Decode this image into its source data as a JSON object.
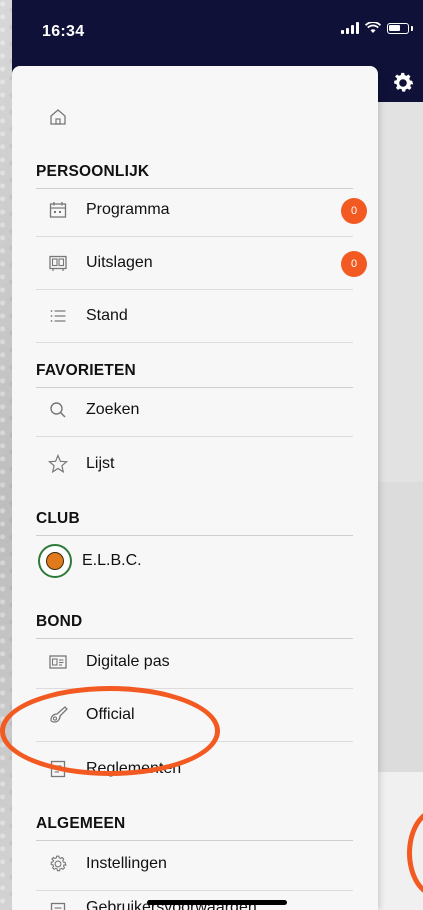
{
  "status": {
    "time": "16:34"
  },
  "menu": {
    "home": "Home",
    "sections": {
      "persoonlijk": "PERSOONLIJK",
      "favorieten": "FAVORIETEN",
      "club": "CLUB",
      "bond": "BOND",
      "algemeen": "ALGEMEEN"
    },
    "items": {
      "programma": "Programma",
      "programma_badge": "0",
      "uitslagen": "Uitslagen",
      "uitslagen_badge": "0",
      "stand": "Stand",
      "zoeken": "Zoeken",
      "lijst": "Lijst",
      "club_name": "E.L.B.C.",
      "digitale_pas": "Digitale pas",
      "official": "Official",
      "reglementen": "Reglementen",
      "instellingen": "Instellingen",
      "gebruikersvoorwaarden": "Gebruikersvoorwaarden"
    }
  },
  "colors": {
    "status_bar": "#0f1138",
    "badge": "#f25a22",
    "annotation": "#f25a22"
  },
  "icons": [
    "home-icon",
    "calendar-icon",
    "scoreboard-icon",
    "list-icon",
    "search-icon",
    "star-icon",
    "club-logo",
    "id-card-icon",
    "whistle-icon",
    "document-icon",
    "settings-icon",
    "gear-icon"
  ]
}
